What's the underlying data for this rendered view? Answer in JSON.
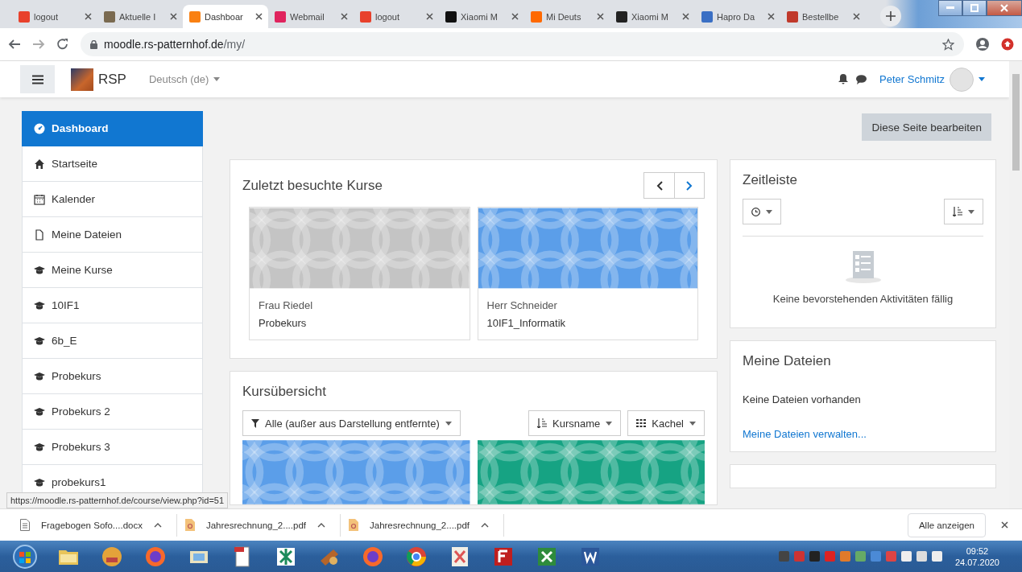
{
  "browser": {
    "tabs": [
      {
        "title": "logout",
        "selected": false,
        "color": "#e8412c"
      },
      {
        "title": "Aktuelle I",
        "selected": false,
        "color": "#7a6a50"
      },
      {
        "title": "Dashboar",
        "selected": true,
        "color": "#f98012"
      },
      {
        "title": "Webmail",
        "selected": false,
        "color": "#e0245e"
      },
      {
        "title": "logout",
        "selected": false,
        "color": "#e8412c"
      },
      {
        "title": "Xiaomi M",
        "selected": false,
        "color": "#111111"
      },
      {
        "title": "Mi Deuts",
        "selected": false,
        "color": "#ff6900"
      },
      {
        "title": "Xiaomi M",
        "selected": false,
        "color": "#222222"
      },
      {
        "title": "Hapro Da",
        "selected": false,
        "color": "#3a6fc4"
      },
      {
        "title": "Bestellbe",
        "selected": false,
        "color": "#c0392b"
      }
    ],
    "url": {
      "host": "moodle.rs-patternhof.de",
      "path": "/my/"
    }
  },
  "navbar": {
    "site_name": "RSP",
    "language": "Deutsch (de)",
    "user": "Peter Schmitz"
  },
  "sidebar": {
    "items": [
      {
        "label": "Dashboard",
        "kind": "dashboard",
        "selected": true
      },
      {
        "label": "Startseite",
        "kind": "home",
        "selected": false
      },
      {
        "label": "Kalender",
        "kind": "calendar",
        "selected": false
      },
      {
        "label": "Meine Dateien",
        "kind": "file",
        "selected": false
      },
      {
        "label": "Meine Kurse",
        "kind": "course",
        "selected": false
      },
      {
        "label": "10IF1",
        "kind": "course",
        "selected": false
      },
      {
        "label": "6b_E",
        "kind": "course",
        "selected": false
      },
      {
        "label": "Probekurs",
        "kind": "course",
        "selected": false
      },
      {
        "label": "Probekurs 2",
        "kind": "course",
        "selected": false
      },
      {
        "label": "Probekurs 3",
        "kind": "course",
        "selected": false
      },
      {
        "label": "probekurs1",
        "kind": "course",
        "selected": false
      }
    ]
  },
  "edit_button": "Diese Seite bearbeiten",
  "recent_courses": {
    "title": "Zuletzt besuchte Kurse",
    "courses": [
      {
        "teacher": "Frau Riedel",
        "name": "Probekurs",
        "color": "#c4c4c4"
      },
      {
        "teacher": "Herr Schneider",
        "name": "10IF1_Informatik",
        "color": "#5b9ee9"
      }
    ]
  },
  "timeline": {
    "title": "Zeitleiste",
    "empty_text": "Keine bevorstehenden Aktivitäten fällig"
  },
  "course_overview": {
    "title": "Kursübersicht",
    "filter": "Alle (außer aus Darstellung entfernte)",
    "sort": "Kursname",
    "view": "Kachel",
    "tiles": [
      {
        "color": "#5b9ee9"
      },
      {
        "color": "#16a383"
      }
    ]
  },
  "files": {
    "title": "Meine Dateien",
    "empty_text": "Keine Dateien vorhanden",
    "manage_link": "Meine Dateien verwalten..."
  },
  "status_url": "https://moodle.rs-patternhof.de/course/view.php?id=51",
  "downloads": {
    "items": [
      {
        "name": "Fragebogen Sofo....docx",
        "kind": "doc"
      },
      {
        "name": "Jahresrechnung_2....pdf",
        "kind": "pdf"
      },
      {
        "name": "Jahresrechnung_2....pdf",
        "kind": "pdf"
      }
    ],
    "show_all": "Alle anzeigen"
  },
  "taskbar": {
    "time": "09:52",
    "date": "24.07.2020"
  }
}
